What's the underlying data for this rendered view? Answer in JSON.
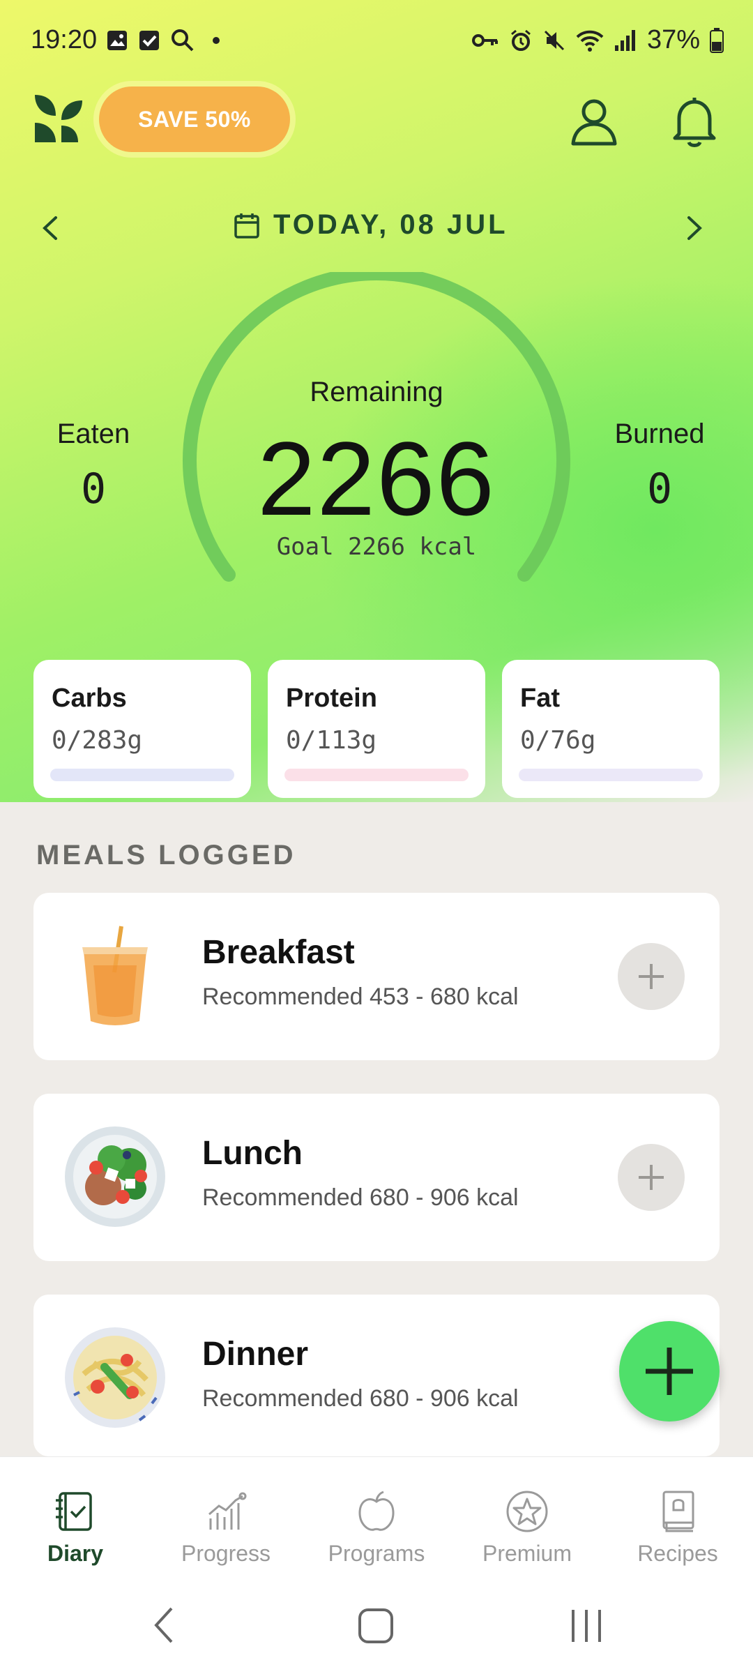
{
  "status_bar": {
    "time": "19:20",
    "battery": "37%"
  },
  "header": {
    "promo_label": "SAVE 50%"
  },
  "date_nav": {
    "label": "TODAY, 08 JUL"
  },
  "summary": {
    "remaining_label": "Remaining",
    "remaining_value": "2266",
    "goal_text": "Goal 2266 kcal",
    "eaten_label": "Eaten",
    "eaten_value": "0",
    "burned_label": "Burned",
    "burned_value": "0"
  },
  "macros": [
    {
      "name": "Carbs",
      "value": "0/283g",
      "progress": 0,
      "bar_color": "#e3e6f8"
    },
    {
      "name": "Protein",
      "value": "0/113g",
      "progress": 0,
      "bar_color": "#fbe0e8"
    },
    {
      "name": "Fat",
      "value": "0/76g",
      "progress": 0,
      "bar_color": "#ebe8f8"
    }
  ],
  "meals_section": {
    "title": "MEALS LOGGED"
  },
  "meals": [
    {
      "title": "Breakfast",
      "recommended": "Recommended 453 - 680 kcal",
      "icon": "juice-cup-icon"
    },
    {
      "title": "Lunch",
      "recommended": "Recommended 680 - 906 kcal",
      "icon": "salad-plate-icon"
    },
    {
      "title": "Dinner",
      "recommended": "Recommended 680 - 906 kcal",
      "icon": "pasta-plate-icon"
    }
  ],
  "bottom_nav": [
    {
      "label": "Diary",
      "icon": "diary-icon",
      "active": true
    },
    {
      "label": "Progress",
      "icon": "progress-chart-icon",
      "active": false
    },
    {
      "label": "Programs",
      "icon": "apple-icon",
      "active": false
    },
    {
      "label": "Premium",
      "icon": "star-icon",
      "active": false
    },
    {
      "label": "Recipes",
      "icon": "recipe-book-icon",
      "active": false
    }
  ],
  "colors": {
    "accent_dark_green": "#1f4a2b",
    "promo_orange": "#f6b24a",
    "fab_green": "#4fe06a",
    "gauge_track": "#6cc85a"
  }
}
